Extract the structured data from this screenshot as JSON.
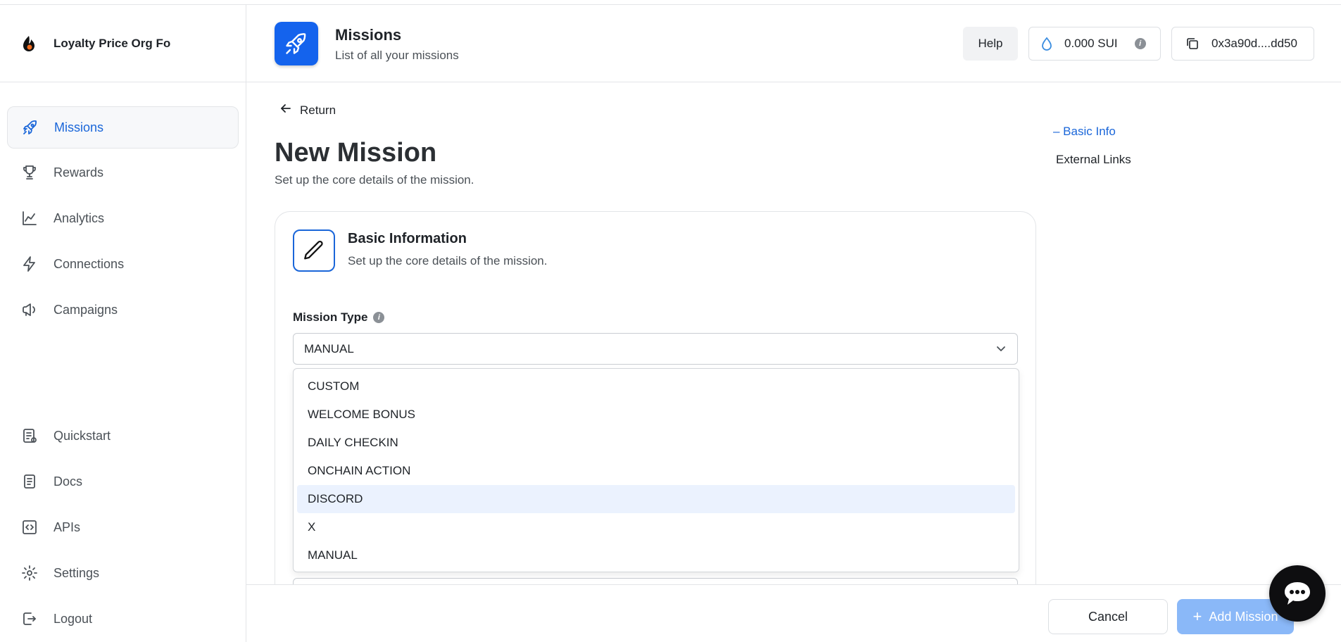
{
  "org": {
    "name": "Loyalty Price Org Fo"
  },
  "sidebar": {
    "top_items": [
      {
        "label": "Missions",
        "icon": "rocket-icon",
        "active": true
      },
      {
        "label": "Rewards",
        "icon": "trophy-icon"
      },
      {
        "label": "Analytics",
        "icon": "chart-line-icon"
      },
      {
        "label": "Connections",
        "icon": "lightning-icon"
      },
      {
        "label": "Campaigns",
        "icon": "megaphone-icon"
      }
    ],
    "bottom_items": [
      {
        "label": "Quickstart",
        "icon": "checklist-icon"
      },
      {
        "label": "Docs",
        "icon": "document-icon"
      },
      {
        "label": "APIs",
        "icon": "code-icon"
      },
      {
        "label": "Settings",
        "icon": "gear-icon"
      },
      {
        "label": "Logout",
        "icon": "logout-icon"
      }
    ]
  },
  "header": {
    "title": "Missions",
    "subtitle": "List of all your missions",
    "help_label": "Help",
    "balance": "0.000 SUI",
    "wallet_address": "0x3a90d....dd50"
  },
  "main": {
    "return_label": "Return",
    "title": "New Mission",
    "subtitle": "Set up the core details of the mission.",
    "card": {
      "title": "Basic Information",
      "subtitle": "Set up the core details of the mission.",
      "mission_type_label": "Mission Type",
      "mission_type_value": "MANUAL"
    },
    "dropdown_options": [
      "CUSTOM",
      "WELCOME BONUS",
      "DAILY CHECKIN",
      "ONCHAIN ACTION",
      "DISCORD",
      "X",
      "MANUAL"
    ],
    "hovered_option": "DISCORD"
  },
  "toc": {
    "active": "– Basic Info",
    "second": "External Links"
  },
  "footer": {
    "cancel_label": "Cancel",
    "add_label": "Add Mission"
  },
  "colors": {
    "accent": "#1463ed",
    "active_text": "#1a66d9",
    "add_button_disabled": "#8ab8f8",
    "hover_option_bg": "#ebf2fe"
  }
}
